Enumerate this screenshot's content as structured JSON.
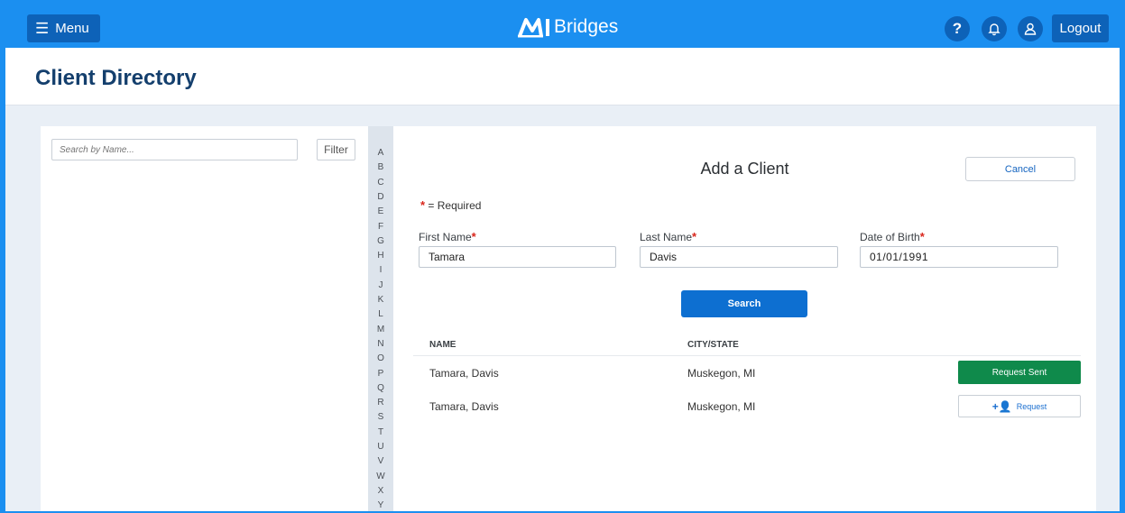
{
  "header": {
    "menu_label": "Menu",
    "brand_name": "Bridges",
    "logout_label": "Logout",
    "help_icon": "?",
    "colors": {
      "bar": "#1b8ff0",
      "button": "#0d62b8"
    }
  },
  "page": {
    "title": "Client Directory"
  },
  "left_panel": {
    "search_placeholder": "Search by Name...",
    "filter_label": "Filter"
  },
  "alphabet": [
    "A",
    "B",
    "C",
    "D",
    "E",
    "F",
    "G",
    "H",
    "I",
    "J",
    "K",
    "L",
    "M",
    "N",
    "O",
    "P",
    "Q",
    "R",
    "S",
    "T",
    "U",
    "V",
    "W",
    "X",
    "Y"
  ],
  "form": {
    "title": "Add a Client",
    "cancel_label": "Cancel",
    "required_note": "= Required",
    "first_name_label": "First Name",
    "last_name_label": "Last Name",
    "dob_label": "Date of Birth",
    "first_name_value": "Tamara",
    "last_name_value": "Davis",
    "dob_value": "01/01/1991",
    "search_label": "Search"
  },
  "results": {
    "col_name": "NAME",
    "col_city": "CITY/STATE",
    "rows": [
      {
        "name": "Tamara, Davis",
        "city": "Muskegon, MI",
        "action": "Request Sent"
      },
      {
        "name": "Tamara, Davis",
        "city": "Muskegon, MI",
        "action": "Request"
      }
    ],
    "colors": {
      "sent": "#0f8a4b",
      "primary": "#0d6fd1"
    }
  }
}
